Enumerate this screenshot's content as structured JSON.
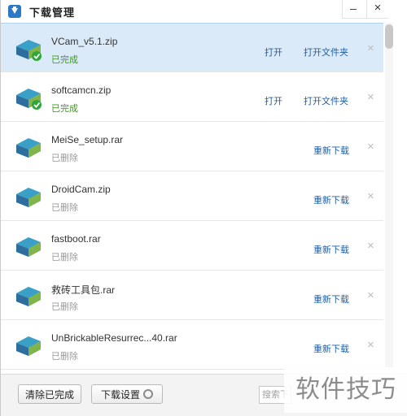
{
  "window": {
    "title": "下载管理",
    "minimize_glyph": "–",
    "close_glyph": "×"
  },
  "downloads": [
    {
      "name": "VCam_v5.1.zip",
      "status": "已完成",
      "state": "done",
      "open": "打开",
      "folder": "打开文件夹",
      "delete": "×"
    },
    {
      "name": "softcamcn.zip",
      "status": "已完成",
      "state": "done",
      "open": "打开",
      "folder": "打开文件夹",
      "delete": "×"
    },
    {
      "name": "MeiSe_setup.rar",
      "status": "已删除",
      "state": "deleted",
      "redownload": "重新下载",
      "delete": "×"
    },
    {
      "name": "DroidCam.zip",
      "status": "已删除",
      "state": "deleted",
      "redownload": "重新下载",
      "delete": "×"
    },
    {
      "name": "fastboot.rar",
      "status": "已删除",
      "state": "deleted",
      "redownload": "重新下载",
      "delete": "×"
    },
    {
      "name": "救砖工具包.rar",
      "status": "已删除",
      "state": "deleted",
      "redownload": "重新下载",
      "delete": "×"
    },
    {
      "name": "UnBrickableResurrec...40.rar",
      "status": "已删除",
      "state": "deleted",
      "redownload": "重新下载",
      "delete": "×"
    }
  ],
  "footer": {
    "clear_label": "清除已完成",
    "settings_label": "下载设置",
    "search_placeholder": "搜索下"
  },
  "watermark": "软件技巧",
  "icons": {
    "app": "download-arrow-icon",
    "file": "archive-books-icon",
    "done_badge": "green-check-icon",
    "settings": "gear-icon"
  },
  "colors": {
    "selected_row": "#dbeaf9",
    "link": "#1d5fa3",
    "done_status": "#3c9a18",
    "deleted_status": "#9a9a9a"
  }
}
